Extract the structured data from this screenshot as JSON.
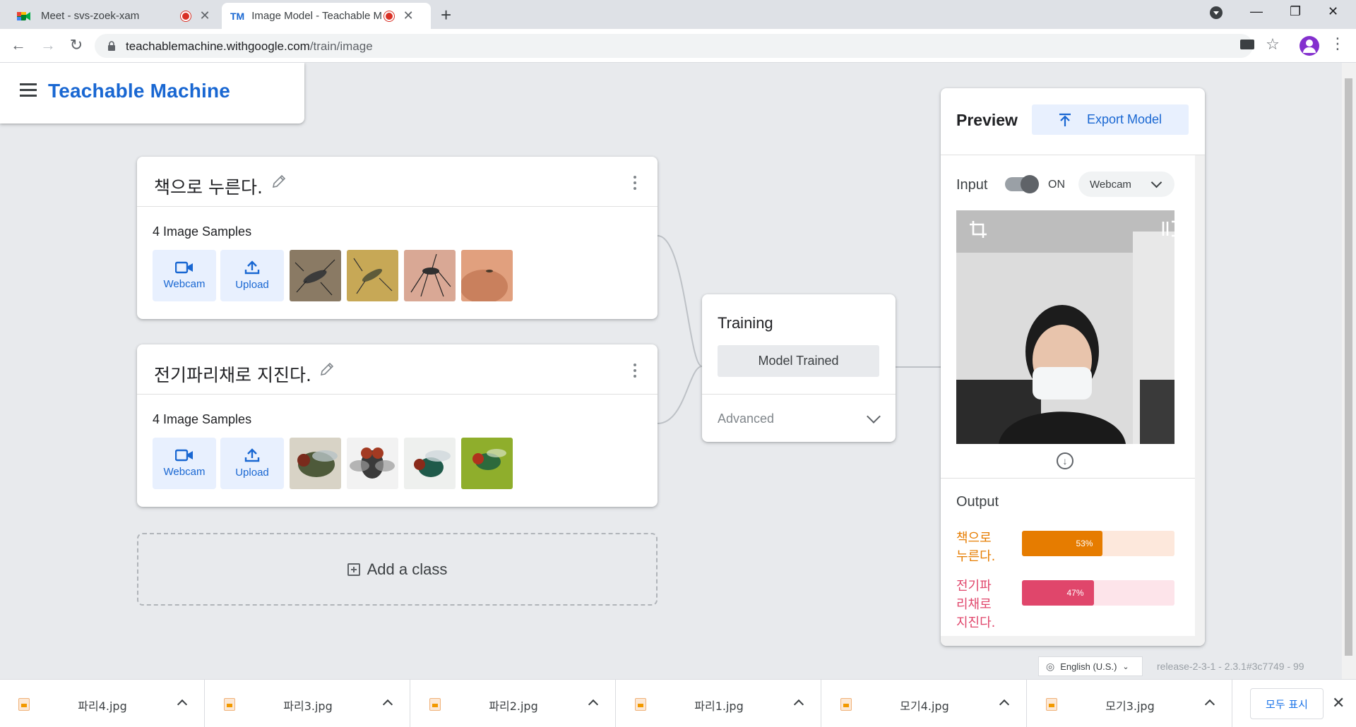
{
  "browser": {
    "tabs": [
      {
        "title": "Meet - svs-zoek-xam",
        "active": false,
        "recording": true
      },
      {
        "title": "Image Model - Teachable M",
        "active": true,
        "recording": true
      }
    ],
    "url_host": "teachablemachine.withgoogle.com",
    "url_path": "/train/image"
  },
  "header": {
    "brand": "Teachable Machine"
  },
  "classes": [
    {
      "name": "책으로 누른다.",
      "samples_label": "4 Image Samples",
      "webcam_label": "Webcam",
      "upload_label": "Upload"
    },
    {
      "name": "전기파리채로 지진다.",
      "samples_label": "4 Image Samples",
      "webcam_label": "Webcam",
      "upload_label": "Upload"
    }
  ],
  "add_class_label": "Add a class",
  "training": {
    "title": "Training",
    "button": "Model Trained",
    "advanced": "Advanced"
  },
  "preview": {
    "title": "Preview",
    "export_label": "Export Model",
    "input_label": "Input",
    "toggle_state": "ON",
    "source": "Webcam",
    "output_title": "Output",
    "outputs": [
      {
        "line1": "책으로",
        "line2": "누른다.",
        "line3": "",
        "percent_label": "53%",
        "value": 0.53,
        "color": "#e67c00",
        "track": "#fde8dc"
      },
      {
        "line1": "전기파",
        "line2": "리채로",
        "line3": "지진다.",
        "percent_label": "47%",
        "value": 0.47,
        "color": "#e0466b",
        "track": "#fde4ea"
      }
    ]
  },
  "footer": {
    "language": "English (U.S.)",
    "release": "release-2-3-1 - 2.3.1#3c7749 - 99"
  },
  "downloads": {
    "files": [
      "파리4.jpg",
      "파리3.jpg",
      "파리2.jpg",
      "파리1.jpg",
      "모기4.jpg",
      "모기3.jpg"
    ],
    "show_all": "모두 표시"
  }
}
